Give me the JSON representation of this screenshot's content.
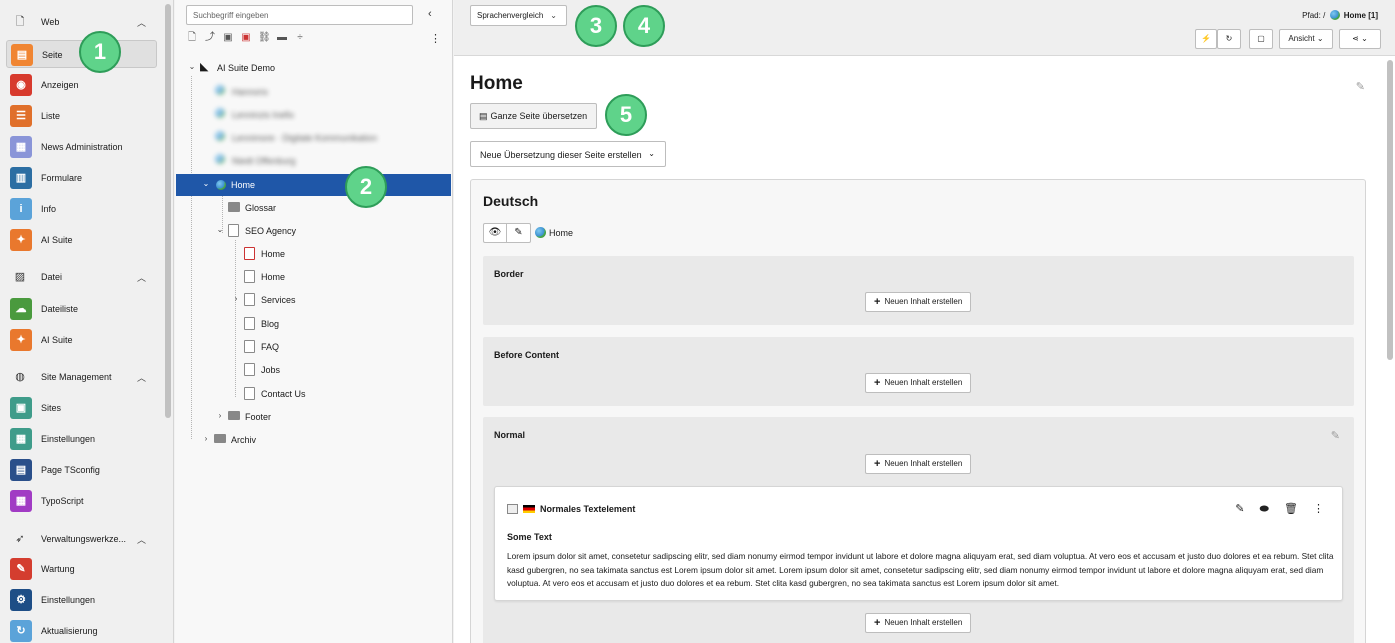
{
  "module_menu": {
    "groups": [
      {
        "label": "Web",
        "items": [
          "Seite",
          "Anzeigen",
          "Liste",
          "News Administration",
          "Formulare",
          "Info",
          "AI Suite"
        ]
      },
      {
        "label": "Datei",
        "items": [
          "Dateiliste",
          "AI Suite"
        ]
      },
      {
        "label": "Site Management",
        "items": [
          "Sites",
          "Einstellungen",
          "Page TSconfig",
          "TypoScript"
        ]
      },
      {
        "label": "Verwaltungswerkze...",
        "items": [
          "Wartung",
          "Einstellungen",
          "Aktualisierung"
        ]
      }
    ],
    "item_colors": {
      "seite": "#f08532",
      "anzeigen": "#d73a2d",
      "liste": "#e0702b",
      "news": "#8a95d8",
      "formulare": "#2c6ea3",
      "info": "#5ba3d9",
      "ai_suite": "#e9782d",
      "dateiliste": "#4a9a3e",
      "sites": "#3f9c8a",
      "einstellungen_site": "#3f9c8a",
      "page_tsconfig": "#2a4f8a",
      "typoscript": "#a13bc4",
      "wartung": "#d43d2f",
      "einstellungen_admin": "#1e4e86",
      "aktualisierung": "#5ba3d9"
    }
  },
  "page_tree": {
    "search_placeholder": "Suchbegriff eingeben",
    "root": "AI Suite Demo",
    "blurred": [
      "Hannorix",
      "Lenninzis Inefix",
      "Lennimore · Digitale Kommunikation",
      "Niedt Offenburg"
    ],
    "home": "Home",
    "glossar": "Glossar",
    "seo_agency": "SEO Agency",
    "seo_children": [
      "Home",
      "Home",
      "Services",
      "Blog",
      "FAQ",
      "Jobs",
      "Contact Us"
    ],
    "footer": "Footer",
    "archiv": "Archiv"
  },
  "header": {
    "language_select": "Sprachenvergleich",
    "path_label": "Pfad: /",
    "path_page": "Home [1]",
    "view_button": "Ansicht"
  },
  "content": {
    "page_title": "Home",
    "translate_button": "Ganze Seite übersetzen",
    "new_translation_select": "Neue Übersetzung dieser Seite erstellen",
    "language_title": "Deutsch",
    "page_link": "Home",
    "new_content_label": "Neuen Inhalt erstellen",
    "columns": [
      "Border",
      "Before Content",
      "Normal"
    ],
    "element": {
      "title": "Normales Textelement",
      "header": "Some Text",
      "body": "Lorem ipsum dolor sit amet, consetetur sadipscing elitr, sed diam nonumy eirmod tempor invidunt ut labore et dolore magna aliquyam erat, sed diam voluptua. At vero eos et accusam et justo duo dolores et ea rebum. Stet clita kasd gubergren, no sea takimata sanctus est Lorem ipsum dolor sit amet. Lorem ipsum dolor sit amet, consetetur sadipscing elitr, sed diam nonumy eirmod tempor invidunt ut labore et dolore magna aliquyam erat, sed diam voluptua. At vero eos et accusam et justo duo dolores et ea rebum. Stet clita kasd gubergren, no sea takimata sanctus est Lorem ipsum dolor sit amet."
    }
  },
  "callouts": [
    "1",
    "2",
    "3",
    "4",
    "5"
  ],
  "colors": {
    "selection": "#1f57a8",
    "callout": "#5fd38a"
  }
}
